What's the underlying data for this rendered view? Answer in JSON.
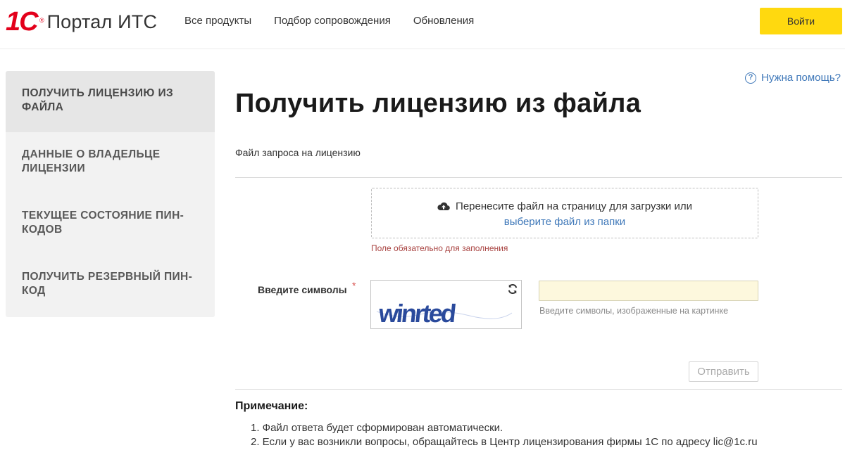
{
  "header": {
    "logo_mark": "1С",
    "logo_reg": "®",
    "logo_text": "Портал ИТС",
    "nav": [
      {
        "label": "Все продукты"
      },
      {
        "label": "Подбор сопровождения"
      },
      {
        "label": "Обновления"
      }
    ],
    "login_label": "Войти"
  },
  "sidebar": {
    "items": [
      {
        "label": "ПОЛУЧИТЬ ЛИЦЕНЗИЮ ИЗ ФАЙЛА",
        "active": true
      },
      {
        "label": "ДАННЫЕ О ВЛАДЕЛЬЦЕ ЛИЦЕНЗИИ",
        "active": false
      },
      {
        "label": "ТЕКУЩЕЕ СОСТОЯНИЕ ПИН-КОДОВ",
        "active": false
      },
      {
        "label": "ПОЛУЧИТЬ РЕЗЕРВНЫЙ ПИН-КОД",
        "active": false
      }
    ]
  },
  "main": {
    "help_label": "Нужна помощь?",
    "title": "Получить лицензию из файла",
    "file_label": "Файл запроса на лицензию",
    "dropzone": {
      "text": "Перенесите файл на страницу для загрузки или",
      "link": "выберите файл из папки"
    },
    "error": "Поле обязательно для заполнения",
    "captcha": {
      "label": "Введите символы",
      "required": "*",
      "code": "winrted",
      "input_value": "",
      "hint": "Введите символы, изображенные на картинке"
    },
    "submit_label": "Отправить",
    "note": {
      "title": "Примечание:",
      "items": [
        "1. Файл ответа будет сформирован автоматически.",
        "2. Если у вас возникли вопросы, обращайтесь в Центр лицензирования фирмы 1С по адресу lic@1c.ru"
      ]
    }
  },
  "colors": {
    "brand_red": "#e3001b",
    "accent_yellow": "#ffd90f",
    "link_blue": "#3f78b9",
    "error_red": "#a94442",
    "captcha_blue": "#2a4a9c"
  }
}
